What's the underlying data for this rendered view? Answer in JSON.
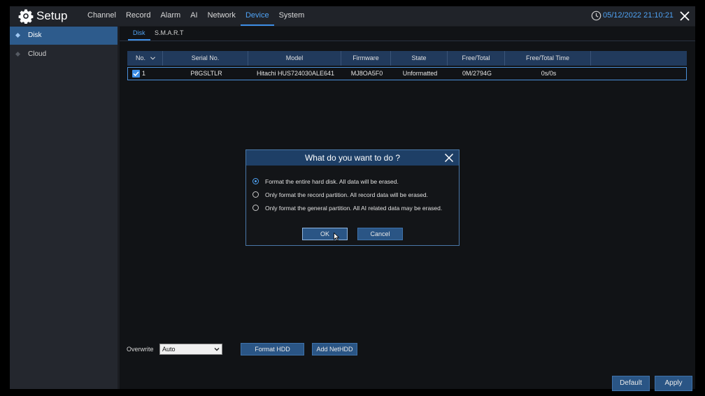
{
  "header": {
    "title": "Setup",
    "nav": [
      "Channel",
      "Record",
      "Alarm",
      "AI",
      "Network",
      "Device",
      "System"
    ],
    "active_nav": "Device",
    "datetime": "05/12/2022 21:10:21",
    "accent_color": "#4fa3f5"
  },
  "sidebar": {
    "items": [
      {
        "label": "Disk",
        "active": true
      },
      {
        "label": "Cloud",
        "active": false
      }
    ]
  },
  "subtabs": [
    "Disk",
    "S.M.A.R.T"
  ],
  "table": {
    "columns": [
      "No.",
      "Serial No.",
      "Model",
      "Firmware",
      "State",
      "Free/Total",
      "Free/Total Time"
    ],
    "rows": [
      {
        "no": "1",
        "serial": "P8GSLTLR",
        "model": "Hitachi HUS724030ALE641",
        "firmware": "MJ8OA5F0",
        "state": "Unformatted",
        "free_total": "0M/2794G",
        "free_total_time": "0s/0s",
        "checked": true
      }
    ]
  },
  "overwrite": {
    "label": "Overwrite",
    "value": "Auto"
  },
  "buttons": {
    "format_hdd": "Format HDD",
    "add_nethdd": "Add NetHDD",
    "default": "Default",
    "apply": "Apply"
  },
  "dialog": {
    "title": "What do you want to do ?",
    "options": [
      {
        "label": "Format the entire hard disk. All data will be erased.",
        "selected": true
      },
      {
        "label": "Only format the record partition. All record data will be erased.",
        "selected": false
      },
      {
        "label": "Only format the general partition. All AI related data may be erased.",
        "selected": false
      }
    ],
    "ok": "OK",
    "cancel": "Cancel"
  }
}
